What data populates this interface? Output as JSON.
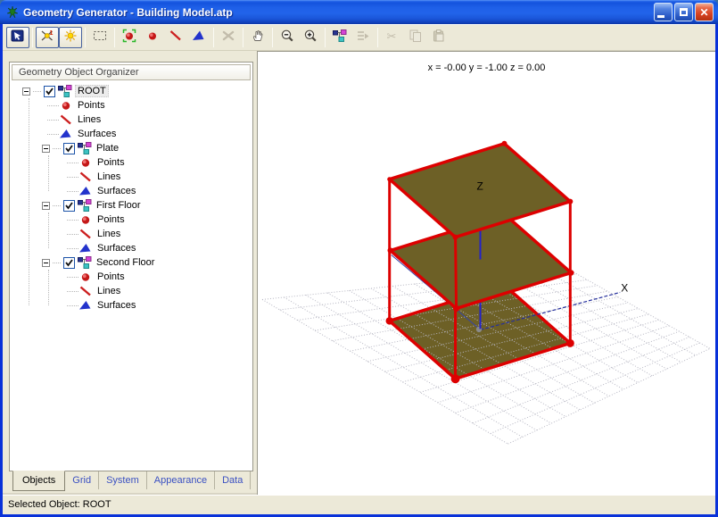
{
  "window": {
    "title": "Geometry Generator - Building Model.atp",
    "buttons": {
      "minimize": "minimize",
      "maximize": "maximize",
      "close": "close"
    }
  },
  "toolbar": {
    "buttons": [
      {
        "name": "view-mode",
        "icon": "view",
        "active": true,
        "enabled": true
      },
      {
        "sep": true
      },
      {
        "name": "snap-to-point",
        "icon": "snap",
        "active": true,
        "enabled": true
      },
      {
        "name": "light",
        "icon": "light",
        "active": true,
        "enabled": true
      },
      {
        "sep": true
      },
      {
        "name": "marquee-select",
        "icon": "marquee",
        "active": false,
        "enabled": true
      },
      {
        "sep": true
      },
      {
        "name": "select-point",
        "icon": "point-select",
        "active": false,
        "enabled": true
      },
      {
        "name": "add-point",
        "icon": "point",
        "active": false,
        "enabled": true
      },
      {
        "name": "add-line",
        "icon": "line",
        "active": false,
        "enabled": true
      },
      {
        "name": "add-surface",
        "icon": "surface",
        "active": false,
        "enabled": true
      },
      {
        "sep": true
      },
      {
        "name": "delete",
        "icon": "delete",
        "active": false,
        "enabled": false
      },
      {
        "sep": true
      },
      {
        "name": "pan",
        "icon": "hand",
        "active": false,
        "enabled": true
      },
      {
        "sep": true
      },
      {
        "name": "zoom-out",
        "icon": "zoom-out",
        "active": false,
        "enabled": true
      },
      {
        "name": "zoom-in",
        "icon": "zoom-in",
        "active": false,
        "enabled": true
      },
      {
        "sep": true
      },
      {
        "name": "organizer",
        "icon": "organizer",
        "active": false,
        "enabled": true
      },
      {
        "name": "move-item",
        "icon": "move-list",
        "active": false,
        "enabled": false
      },
      {
        "sep": true
      },
      {
        "name": "cut",
        "icon": "cut",
        "active": false,
        "enabled": false
      },
      {
        "name": "copy",
        "icon": "copy",
        "active": false,
        "enabled": false
      },
      {
        "name": "paste",
        "icon": "paste",
        "active": false,
        "enabled": false
      }
    ]
  },
  "organizer": {
    "header": "Geometry Object Organizer",
    "tree": [
      {
        "label": "ROOT",
        "kind": "group",
        "checked": true,
        "expanded": true,
        "selected": true,
        "children": [
          {
            "label": "Points",
            "kind": "leaf",
            "icon": "points"
          },
          {
            "label": "Lines",
            "kind": "leaf",
            "icon": "lines"
          },
          {
            "label": "Surfaces",
            "kind": "leaf",
            "icon": "surfaces"
          },
          {
            "label": "Plate",
            "kind": "group",
            "checked": true,
            "expanded": true,
            "children": [
              {
                "label": "Points",
                "kind": "leaf",
                "icon": "points"
              },
              {
                "label": "Lines",
                "kind": "leaf",
                "icon": "lines"
              },
              {
                "label": "Surfaces",
                "kind": "leaf",
                "icon": "surfaces"
              }
            ]
          },
          {
            "label": "First Floor",
            "kind": "group",
            "checked": true,
            "expanded": true,
            "children": [
              {
                "label": "Points",
                "kind": "leaf",
                "icon": "points"
              },
              {
                "label": "Lines",
                "kind": "leaf",
                "icon": "lines"
              },
              {
                "label": "Surfaces",
                "kind": "leaf",
                "icon": "surfaces"
              }
            ]
          },
          {
            "label": "Second Floor",
            "kind": "group",
            "checked": true,
            "expanded": true,
            "children": [
              {
                "label": "Points",
                "kind": "leaf",
                "icon": "points"
              },
              {
                "label": "Lines",
                "kind": "leaf",
                "icon": "lines"
              },
              {
                "label": "Surfaces",
                "kind": "leaf",
                "icon": "surfaces"
              }
            ]
          }
        ]
      }
    ]
  },
  "tabs": {
    "items": [
      {
        "label": "Objects",
        "active": true
      },
      {
        "label": "Grid",
        "active": false
      },
      {
        "label": "System",
        "active": false
      },
      {
        "label": "Appearance",
        "active": false
      },
      {
        "label": "Data",
        "active": false
      }
    ]
  },
  "viewport": {
    "coords": "x = -0.00   y = -1.00   z = 0.00",
    "z_label": "Z",
    "x_label": "X"
  },
  "statusbar": {
    "text": "Selected Object: ROOT"
  },
  "colors": {
    "titlebar_blue": "#1e5fe8",
    "window_border": "#0831d9",
    "chrome_beige": "#ece9d8",
    "plate_fill": "#6d6026",
    "edge_red": "#dd0000",
    "axis_blue": "#2222cc",
    "grid_gray": "#b6b6c2",
    "tab_link_blue": "#3a50c2"
  }
}
